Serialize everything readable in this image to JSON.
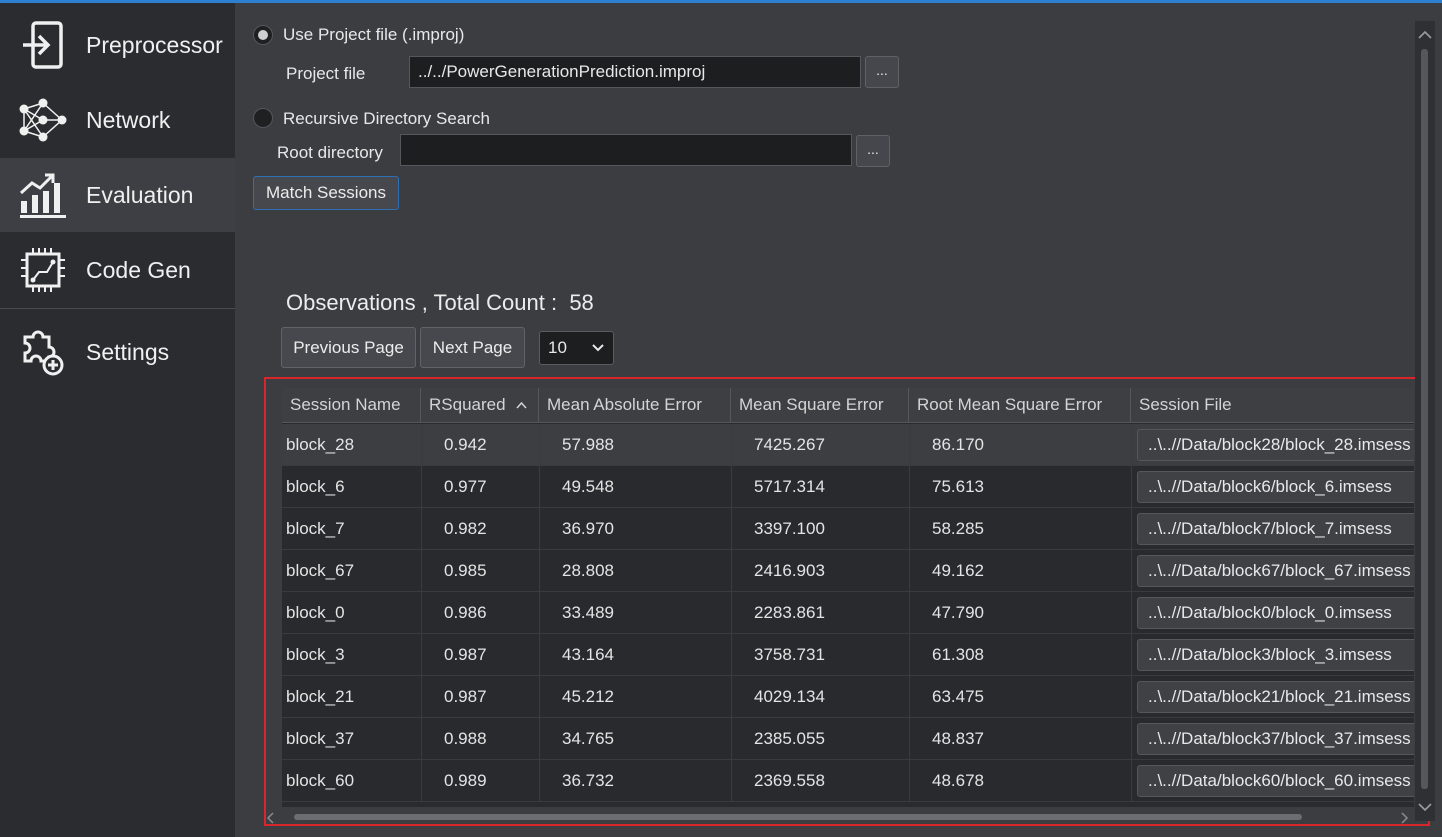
{
  "sidebar": {
    "items": [
      {
        "label": "Preprocessor",
        "icon": "login-arrow-icon"
      },
      {
        "label": "Network",
        "icon": "neural-network-icon"
      },
      {
        "label": "Evaluation",
        "icon": "chart-growth-icon"
      },
      {
        "label": "Code Gen",
        "icon": "chip-icon"
      },
      {
        "label": "Settings",
        "icon": "puzzle-plus-icon"
      }
    ],
    "active": "Evaluation"
  },
  "source": {
    "use_project_label": "Use Project file (.improj)",
    "project_file_label": "Project file",
    "project_file_value": "../../PowerGenerationPrediction.improj",
    "browse_label": "...",
    "recursive_label": "Recursive Directory Search",
    "root_dir_label": "Root directory",
    "root_dir_value": "",
    "match_sessions_label": "Match Sessions"
  },
  "observations": {
    "title": "Observations , Total Count :",
    "count": "58",
    "prev_label": "Previous Page",
    "next_label": "Next Page",
    "page_size": "10"
  },
  "table": {
    "columns": [
      "Session Name",
      "RSquared",
      "Mean Absolute Error",
      "Mean Square Error",
      "Root Mean Square Error",
      "Session File"
    ],
    "sorted_column": "RSquared",
    "rows": [
      {
        "name": "block_28",
        "r2": "0.942",
        "mae": "57.988",
        "mse": "7425.267",
        "rmse": "86.170",
        "file": "..\\..//Data/block28/block_28.imsess"
      },
      {
        "name": "block_6",
        "r2": "0.977",
        "mae": "49.548",
        "mse": "5717.314",
        "rmse": "75.613",
        "file": "..\\..//Data/block6/block_6.imsess"
      },
      {
        "name": "block_7",
        "r2": "0.982",
        "mae": "36.970",
        "mse": "3397.100",
        "rmse": "58.285",
        "file": "..\\..//Data/block7/block_7.imsess"
      },
      {
        "name": "block_67",
        "r2": "0.985",
        "mae": "28.808",
        "mse": "2416.903",
        "rmse": "49.162",
        "file": "..\\..//Data/block67/block_67.imsess"
      },
      {
        "name": "block_0",
        "r2": "0.986",
        "mae": "33.489",
        "mse": "2283.861",
        "rmse": "47.790",
        "file": "..\\..//Data/block0/block_0.imsess"
      },
      {
        "name": "block_3",
        "r2": "0.987",
        "mae": "43.164",
        "mse": "3758.731",
        "rmse": "61.308",
        "file": "..\\..//Data/block3/block_3.imsess"
      },
      {
        "name": "block_21",
        "r2": "0.987",
        "mae": "45.212",
        "mse": "4029.134",
        "rmse": "63.475",
        "file": "..\\..//Data/block21/block_21.imsess"
      },
      {
        "name": "block_37",
        "r2": "0.988",
        "mae": "34.765",
        "mse": "2385.055",
        "rmse": "48.837",
        "file": "..\\..//Data/block37/block_37.imsess"
      },
      {
        "name": "block_60",
        "r2": "0.989",
        "mae": "36.732",
        "mse": "2369.558",
        "rmse": "48.678",
        "file": "..\\..//Data/block60/block_60.imsess"
      }
    ]
  }
}
